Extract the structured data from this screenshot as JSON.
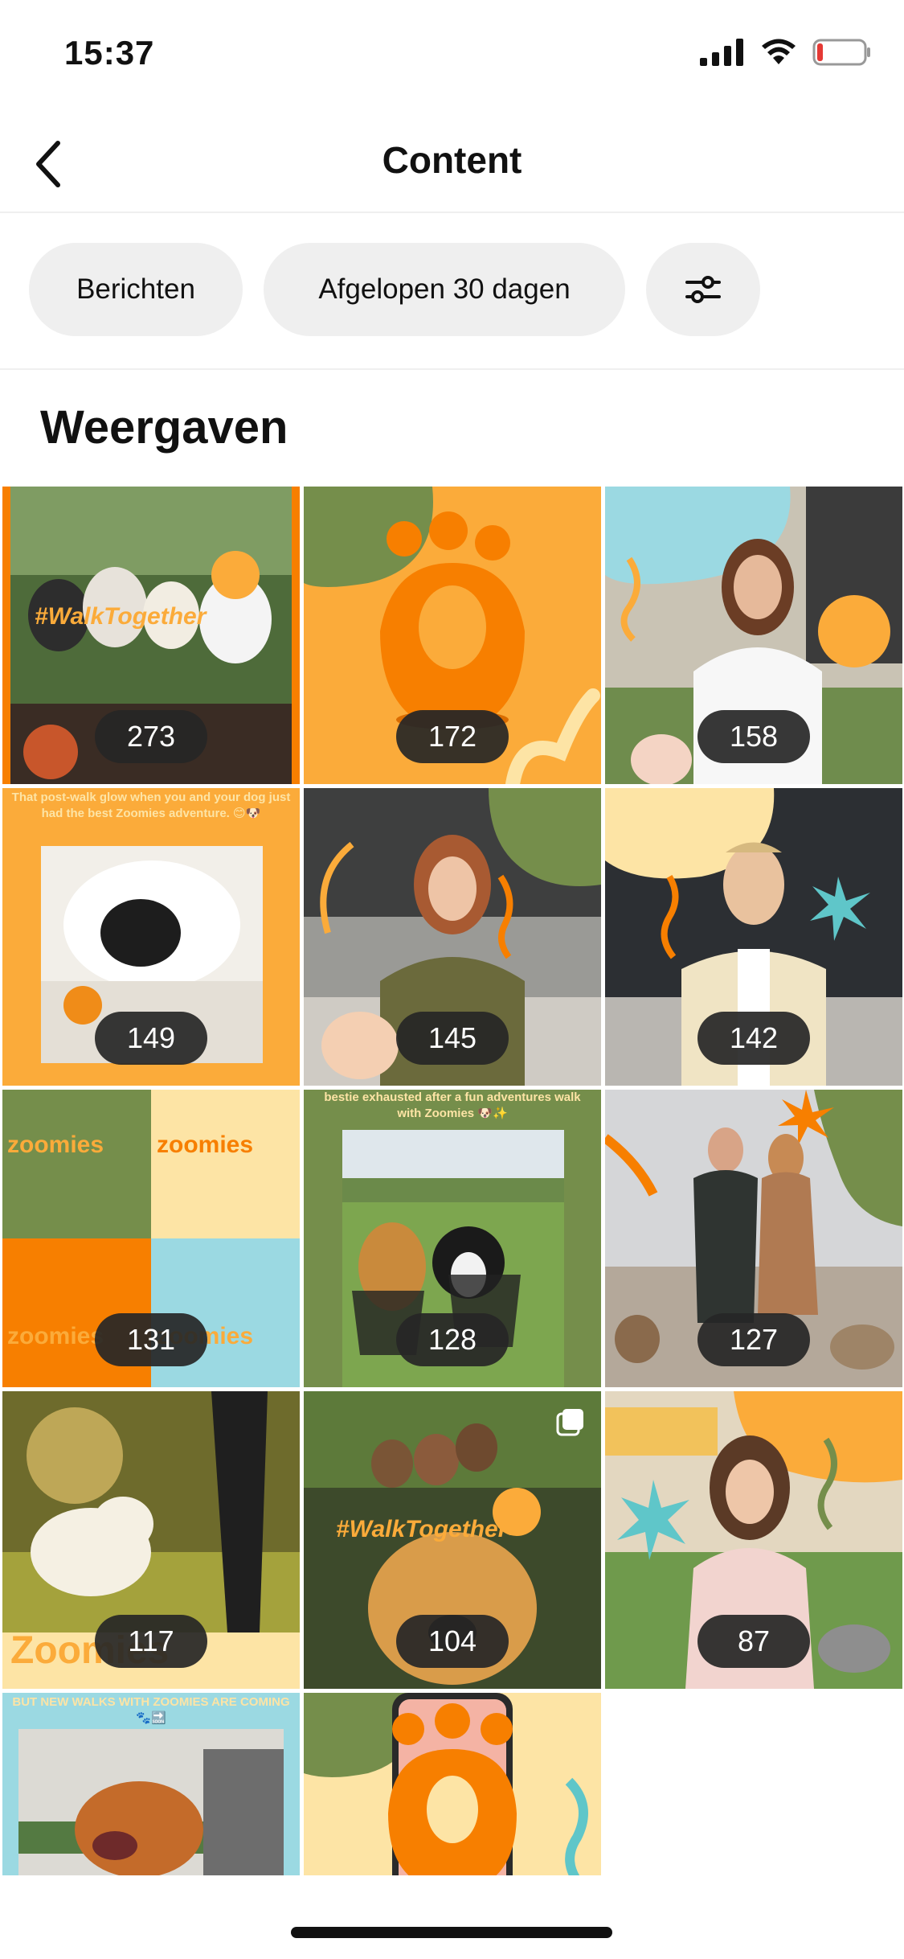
{
  "status_bar": {
    "time": "15:37"
  },
  "nav": {
    "title": "Content"
  },
  "filters": {
    "type": "Berichten",
    "period": "Afgelopen 30 dagen"
  },
  "section": {
    "title": "Weergaven"
  },
  "colors": {
    "orange": "#f77f00",
    "light_orange": "#fbab3a",
    "olive": "#758e4b",
    "cream": "#fde4a5",
    "sky": "#9bd9e2",
    "chip_bg": "#efefef"
  },
  "posts": [
    {
      "views": "273",
      "caption": "#WalkTogether"
    },
    {
      "views": "172"
    },
    {
      "views": "158"
    },
    {
      "views": "149",
      "caption": "That post-walk glow when you and your dog just had the best Zoomies adventure. 😊🐶"
    },
    {
      "views": "145"
    },
    {
      "views": "142"
    },
    {
      "views": "131",
      "brand": "zoomies"
    },
    {
      "views": "128",
      "caption": "bestie exhausted after a fun adventures walk with Zoomies 🐶✨"
    },
    {
      "views": "127"
    },
    {
      "views": "117",
      "brand": "Zoomies"
    },
    {
      "views": "104",
      "caption": "#WalkTogether"
    },
    {
      "views": "87"
    },
    {
      "caption": "BUT NEW WALKS WITH ZOOMIES ARE COMING 🐾🔜"
    },
    {}
  ]
}
